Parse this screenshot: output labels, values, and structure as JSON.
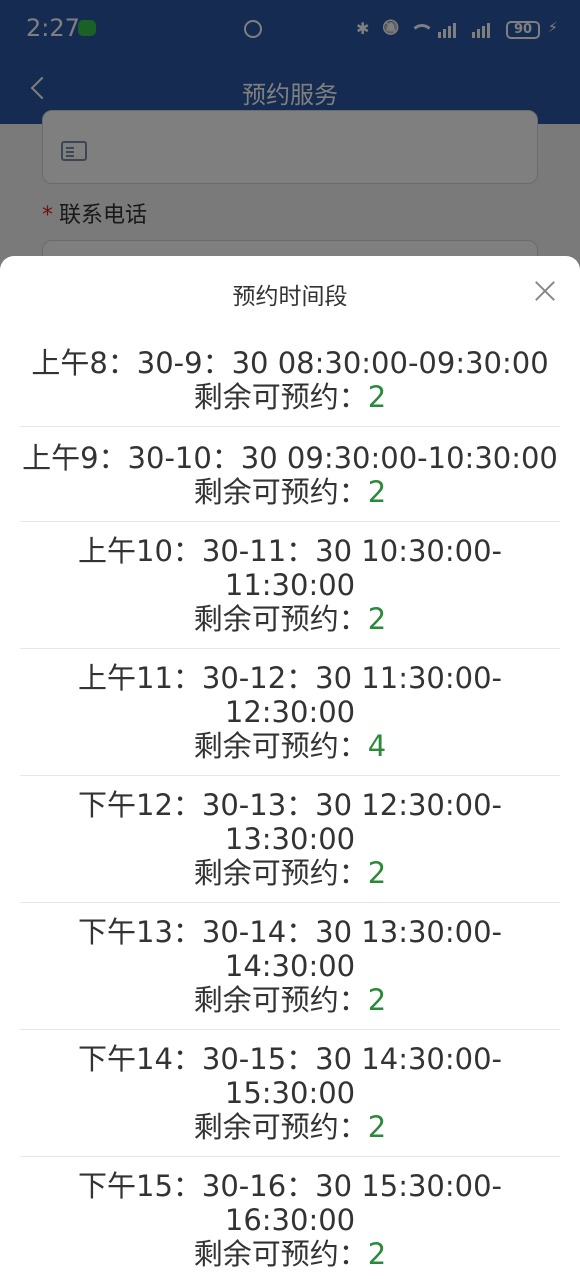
{
  "status_bar": {
    "time": "2:27",
    "battery": "90"
  },
  "nav": {
    "title": "预约服务"
  },
  "form": {
    "phone_label": "联系电话",
    "required_mark": "*"
  },
  "sheet": {
    "title": "预约时间段",
    "remaining_label": "剩余可预约：",
    "slots": [
      {
        "time": "上午8：30-9：30 08:30:00-09:30:00",
        "remaining": "2"
      },
      {
        "time": "上午9：30-10：30 09:30:00-10:30:00",
        "remaining": "2"
      },
      {
        "time_line1": "上午10：30-11：30 10:30:00-",
        "time_line2": "11:30:00",
        "remaining": "2"
      },
      {
        "time_line1": "上午11：30-12：30 11:30:00-",
        "time_line2": "12:30:00",
        "remaining": "4"
      },
      {
        "time_line1": "下午12：30-13：30 12:30:00-",
        "time_line2": "13:30:00",
        "remaining": "2"
      },
      {
        "time_line1": "下午13：30-14：30 13:30:00-",
        "time_line2": "14:30:00",
        "remaining": "2"
      },
      {
        "time_line1": "下午14：30-15：30 14:30:00-",
        "time_line2": "15:30:00",
        "remaining": "2"
      },
      {
        "time_line1": "下午15：30-16：30 15:30:00-",
        "time_line2": "16:30:00",
        "remaining": "2"
      }
    ]
  }
}
